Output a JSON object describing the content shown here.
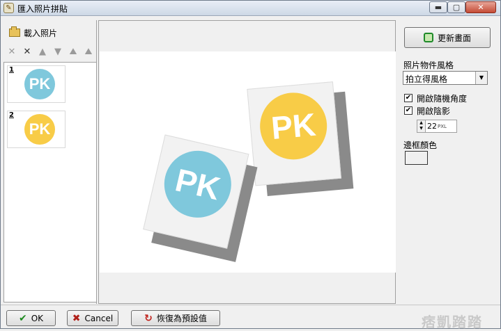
{
  "window": {
    "title": "匯入照片拼貼",
    "min_glyph": "▬",
    "max_glyph": "▢",
    "close_glyph": "✕"
  },
  "left_panel": {
    "load_label": "載入照片",
    "tools": {
      "remove": "✕",
      "remove_all": "✕",
      "up": "▲",
      "down": "▼",
      "rotate_left": "⛰",
      "rotate_right": "⛰"
    },
    "thumbnails": [
      {
        "index": "1",
        "logo_text": "PK",
        "color": "#7fc8dc"
      },
      {
        "index": "2",
        "logo_text": "PK",
        "color": "#f8cc47"
      }
    ]
  },
  "preview": {
    "photos": [
      {
        "logo_text": "PK",
        "color": "#7fc8dc"
      },
      {
        "logo_text": "PK",
        "color": "#f8cc47"
      }
    ]
  },
  "right_panel": {
    "refresh_label": "更新畫面",
    "style_label": "照片物件風格",
    "style_value": "拍立得風格",
    "random_angle_label": "開啟隨機角度",
    "random_angle_checked": "✔",
    "shadow_label": "開啟陰影",
    "shadow_checked": "✔",
    "shadow_size": "22",
    "shadow_unit": "PXL",
    "border_color_label": "邊框顏色"
  },
  "bottom": {
    "ok_label": "OK",
    "cancel_label": "Cancel",
    "reset_label": "恢復為預設值",
    "watermark": "痞凱踏踏"
  },
  "colors": {
    "blue_logo": "#7fc8dc",
    "yellow_logo": "#f8cc47"
  }
}
